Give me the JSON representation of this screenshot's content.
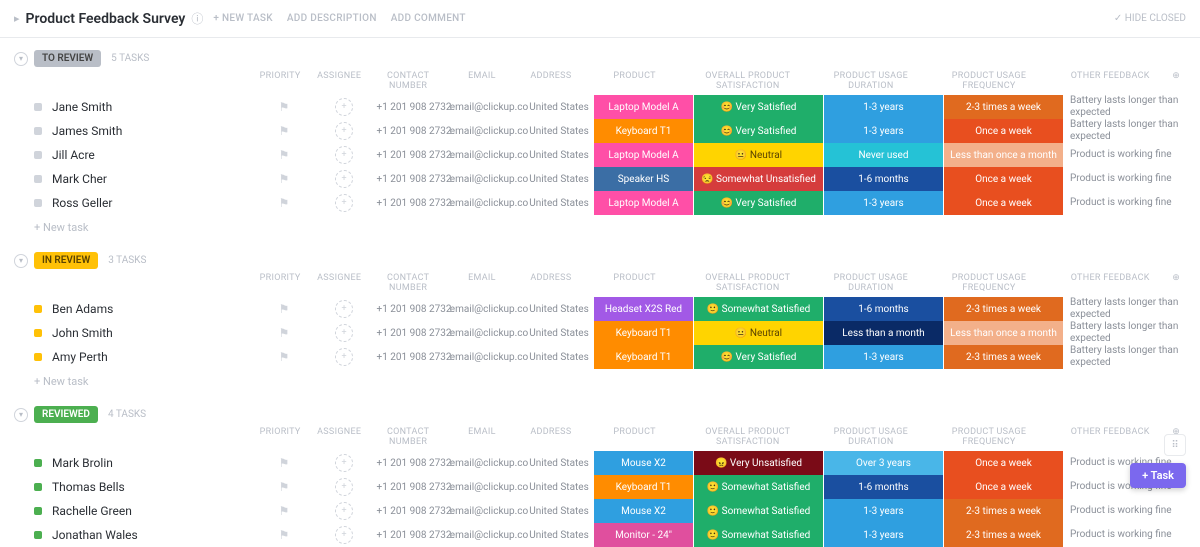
{
  "header": {
    "title": "Product Feedback Survey",
    "new_task": "+ NEW TASK",
    "add_description": "ADD DESCRIPTION",
    "add_comment": "ADD COMMENT",
    "hide_closed": "HIDE CLOSED"
  },
  "columns": {
    "priority": "PRIORITY",
    "assignee": "ASSIGNEE",
    "contact": "CONTACT NUMBER",
    "email": "EMAIL",
    "address": "ADDRESS",
    "product": "PRODUCT",
    "satisfaction": "OVERALL PRODUCT SATISFACTION",
    "duration": "PRODUCT USAGE DURATION",
    "frequency": "PRODUCT USAGE FREQUENCY",
    "feedback": "OTHER FEEDBACK"
  },
  "shared": {
    "contact": "+1 201 908 2732",
    "email": "email@clickup.co",
    "address": "United States",
    "new_task": "+ New task"
  },
  "colors": {
    "product": {
      "Laptop Model A": "#ff4fa7",
      "Keyboard T1": "#ff8c00",
      "Speaker HS": "#3b6ea5",
      "Headset X2S Red": "#a259e6",
      "Mouse X2": "#2f9fe0",
      "Monitor - 24\"": "#e04f9e"
    },
    "satisfaction": {
      "Very Satisfied": "#1fae6a",
      "Neutral": "#ffd400",
      "Somewhat Unsatisfied": "#d53c3c",
      "Somewhat Satisfied": "#1fae6a",
      "Very Unsatisfied": "#7a0b17"
    },
    "duration": {
      "1-3 years": "#2f9fe0",
      "Never used": "#25c2d6",
      "1-6 months": "#1a4fa0",
      "Less than a month": "#0a2a66",
      "Over 3 years": "#49b6e8"
    },
    "frequency": {
      "2-3 times a week": "#e06a1f",
      "Once a week": "#e84f1f",
      "Less than once a month": "#f3b08a"
    },
    "neutral_text": "#5a4300"
  },
  "emoji": {
    "Very Satisfied": "😊",
    "Neutral": "😐",
    "Somewhat Unsatisfied": "😒",
    "Somewhat Satisfied": "🙂",
    "Very Unsatisfied": "😠"
  },
  "groups": [
    {
      "status": "TO REVIEW",
      "pill_class": "gray",
      "dot_class": "gray",
      "count": "5 TASKS",
      "show_new_task": true,
      "rows": [
        {
          "name": "Jane Smith",
          "product": "Laptop Model A",
          "satisfaction": "Very Satisfied",
          "duration": "1-3 years",
          "frequency": "2-3 times a week",
          "feedback": "Battery lasts longer than expected"
        },
        {
          "name": "James Smith",
          "product": "Keyboard T1",
          "satisfaction": "Very Satisfied",
          "duration": "1-3 years",
          "frequency": "Once a week",
          "feedback": "Battery lasts longer than expected"
        },
        {
          "name": "Jill Acre",
          "product": "Laptop Model A",
          "satisfaction": "Neutral",
          "duration": "Never used",
          "frequency": "Less than once a month",
          "feedback": "Product is working fine"
        },
        {
          "name": "Mark Cher",
          "product": "Speaker HS",
          "satisfaction": "Somewhat Unsatisfied",
          "duration": "1-6 months",
          "frequency": "Once a week",
          "feedback": "Product is working fine"
        },
        {
          "name": "Ross Geller",
          "product": "Laptop Model A",
          "satisfaction": "Very Satisfied",
          "duration": "1-3 years",
          "frequency": "Once a week",
          "feedback": "Product is working fine"
        }
      ]
    },
    {
      "status": "IN REVIEW",
      "pill_class": "yellow",
      "dot_class": "yellow",
      "count": "3 TASKS",
      "show_new_task": true,
      "rows": [
        {
          "name": "Ben Adams",
          "product": "Headset X2S Red",
          "satisfaction": "Somewhat Satisfied",
          "duration": "1-6 months",
          "frequency": "2-3 times a week",
          "feedback": "Battery lasts longer than expected"
        },
        {
          "name": "John Smith",
          "product": "Keyboard T1",
          "satisfaction": "Neutral",
          "duration": "Less than a month",
          "frequency": "Less than once a month",
          "feedback": "Battery lasts longer than expected"
        },
        {
          "name": "Amy Perth",
          "product": "Keyboard T1",
          "satisfaction": "Very Satisfied",
          "duration": "1-3 years",
          "frequency": "2-3 times a week",
          "feedback": "Battery lasts longer than expected"
        }
      ]
    },
    {
      "status": "REVIEWED",
      "pill_class": "green",
      "dot_class": "green",
      "count": "4 TASKS",
      "show_new_task": false,
      "rows": [
        {
          "name": "Mark Brolin",
          "product": "Mouse X2",
          "satisfaction": "Very Unsatisfied",
          "duration": "Over 3 years",
          "frequency": "Once a week",
          "feedback": "Product is working fine"
        },
        {
          "name": "Thomas Bells",
          "product": "Keyboard T1",
          "satisfaction": "Somewhat Satisfied",
          "duration": "1-6 months",
          "frequency": "Once a week",
          "feedback": "Product is working fine"
        },
        {
          "name": "Rachelle Green",
          "product": "Mouse X2",
          "satisfaction": "Somewhat Satisfied",
          "duration": "1-3 years",
          "frequency": "2-3 times a week",
          "feedback": "Product is working fine"
        },
        {
          "name": "Jonathan Wales",
          "product": "Monitor - 24\"",
          "satisfaction": "Somewhat Satisfied",
          "duration": "1-3 years",
          "frequency": "2-3 times a week",
          "feedback": "Product is working fine"
        }
      ]
    }
  ],
  "float": {
    "task": "+ Task"
  }
}
